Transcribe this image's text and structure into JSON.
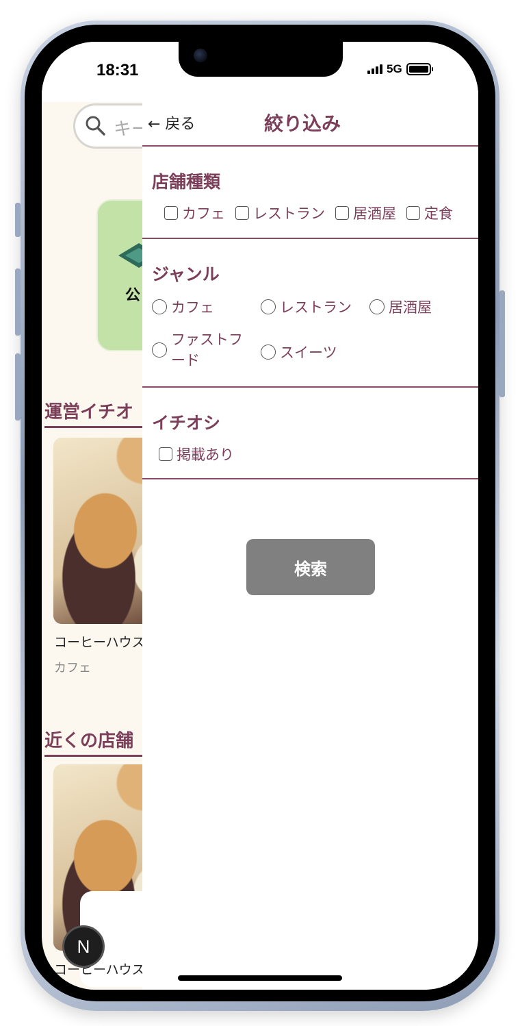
{
  "status_bar": {
    "time": "18:31",
    "network": "5G"
  },
  "background_page": {
    "search_placeholder": "キー",
    "card_text": "公",
    "heading_recommended": "運営イチオ",
    "heading_nearby": "近くの店舗",
    "food_caption_1": "コーヒーハウス",
    "food_genre_1": "カフェ",
    "food_caption_2": "コーヒーハウス",
    "n_badge": "N"
  },
  "filter": {
    "back_label": "← 戻る",
    "title": "絞り込み",
    "store_type": {
      "title": "店舗種類",
      "options": [
        "カフェ",
        "レストラン",
        "居酒屋",
        "定食"
      ]
    },
    "genre": {
      "title": "ジャンル",
      "options": [
        "カフェ",
        "レストラン",
        "居酒屋",
        "ファストフード",
        "スイーツ"
      ]
    },
    "ichioshi": {
      "title": "イチオシ",
      "options": [
        "掲載あり"
      ]
    },
    "search_button": "検索"
  },
  "colors": {
    "accent": "#7b3f5a",
    "button": "#808080",
    "page_bg": "#fdf8ef",
    "card_green": "#c3e2a7"
  }
}
